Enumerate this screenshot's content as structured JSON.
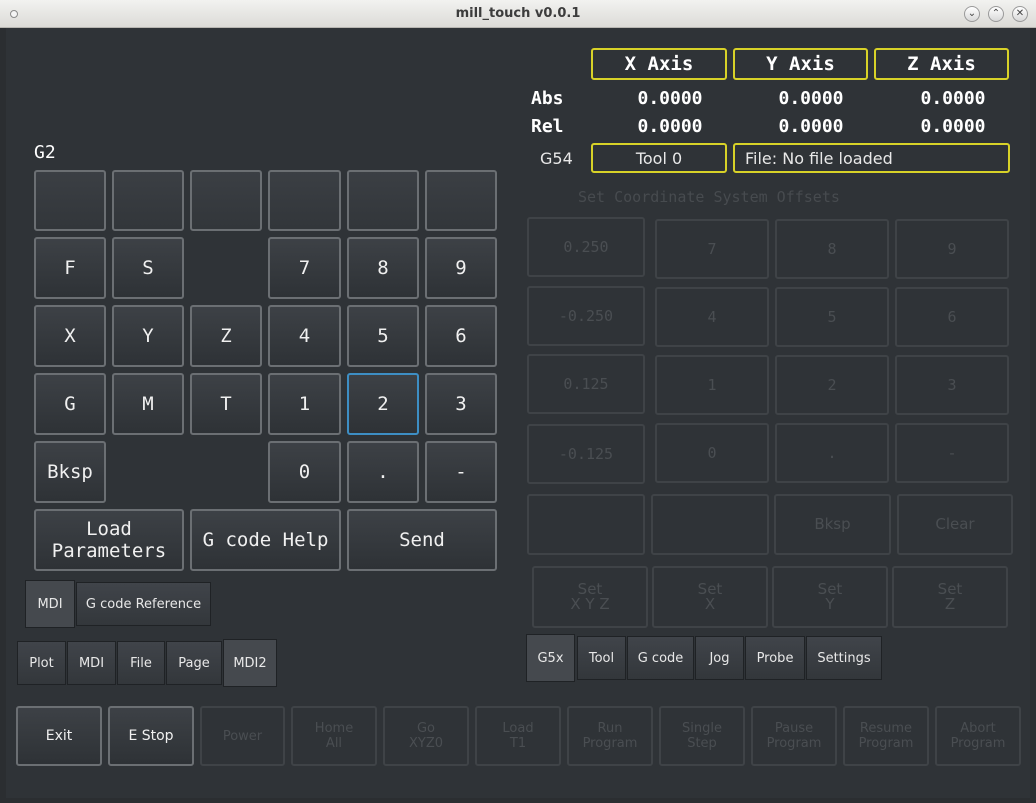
{
  "window": {
    "title": "mill_touch v0.0.1",
    "btn_min": "⌄",
    "btn_max": "⌃",
    "btn_close": "✕"
  },
  "dro": {
    "headers": [
      "X Axis",
      "Y Axis",
      "Z Axis"
    ],
    "abs_label": "Abs",
    "rel_label": "Rel",
    "abs": [
      "0.0000",
      "0.0000",
      "0.0000"
    ],
    "rel": [
      "0.0000",
      "0.0000",
      "0.0000"
    ],
    "coord_system": "G54",
    "tool": "Tool 0",
    "file": "File: No file loaded"
  },
  "mdi": {
    "modal_text": "G2",
    "keys": {
      "F": "F",
      "S": "S",
      "X": "X",
      "Y": "Y",
      "Z": "Z",
      "G": "G",
      "M": "M",
      "T": "T",
      "bksp": "Bksp",
      "n7": "7",
      "n8": "8",
      "n9": "9",
      "n4": "4",
      "n5": "5",
      "n6": "6",
      "n1": "1",
      "n2": "2",
      "n3": "3",
      "n0": "0",
      "dot": ".",
      "minus": "-"
    },
    "load_params": "Load\nParameters",
    "gcode_help": "G code Help",
    "send": "Send",
    "subtabs": [
      "MDI",
      "G code Reference"
    ]
  },
  "main_tabs": [
    "Plot",
    "MDI",
    "File",
    "Page",
    "MDI2"
  ],
  "offsets": {
    "title": "Set Coordinate System Offsets",
    "steps": [
      "0.250",
      "-0.250",
      "0.125",
      "-0.125"
    ],
    "keys": [
      "7",
      "8",
      "9",
      "4",
      "5",
      "6",
      "1",
      "2",
      "3",
      "0",
      ".",
      "-"
    ],
    "bksp": "Bksp",
    "clear": "Clear",
    "set_xyz": "Set\nX Y Z",
    "set_x": "Set\nX",
    "set_y": "Set\nY",
    "set_z": "Set\nZ"
  },
  "right_tabs": [
    "G5x",
    "Tool",
    "G code",
    "Jog",
    "Probe",
    "Settings"
  ],
  "bottom": {
    "exit": "Exit",
    "estop": "E Stop",
    "power": "Power",
    "home_all": "Home\nAll",
    "go_xyz0": "Go\nXYZ0",
    "load_t1": "Load\nT1",
    "run": "Run\nProgram",
    "single_step": "Single\nStep",
    "pause": "Pause\nProgram",
    "resume": "Resume\nProgram",
    "abort": "Abort\nProgram"
  }
}
